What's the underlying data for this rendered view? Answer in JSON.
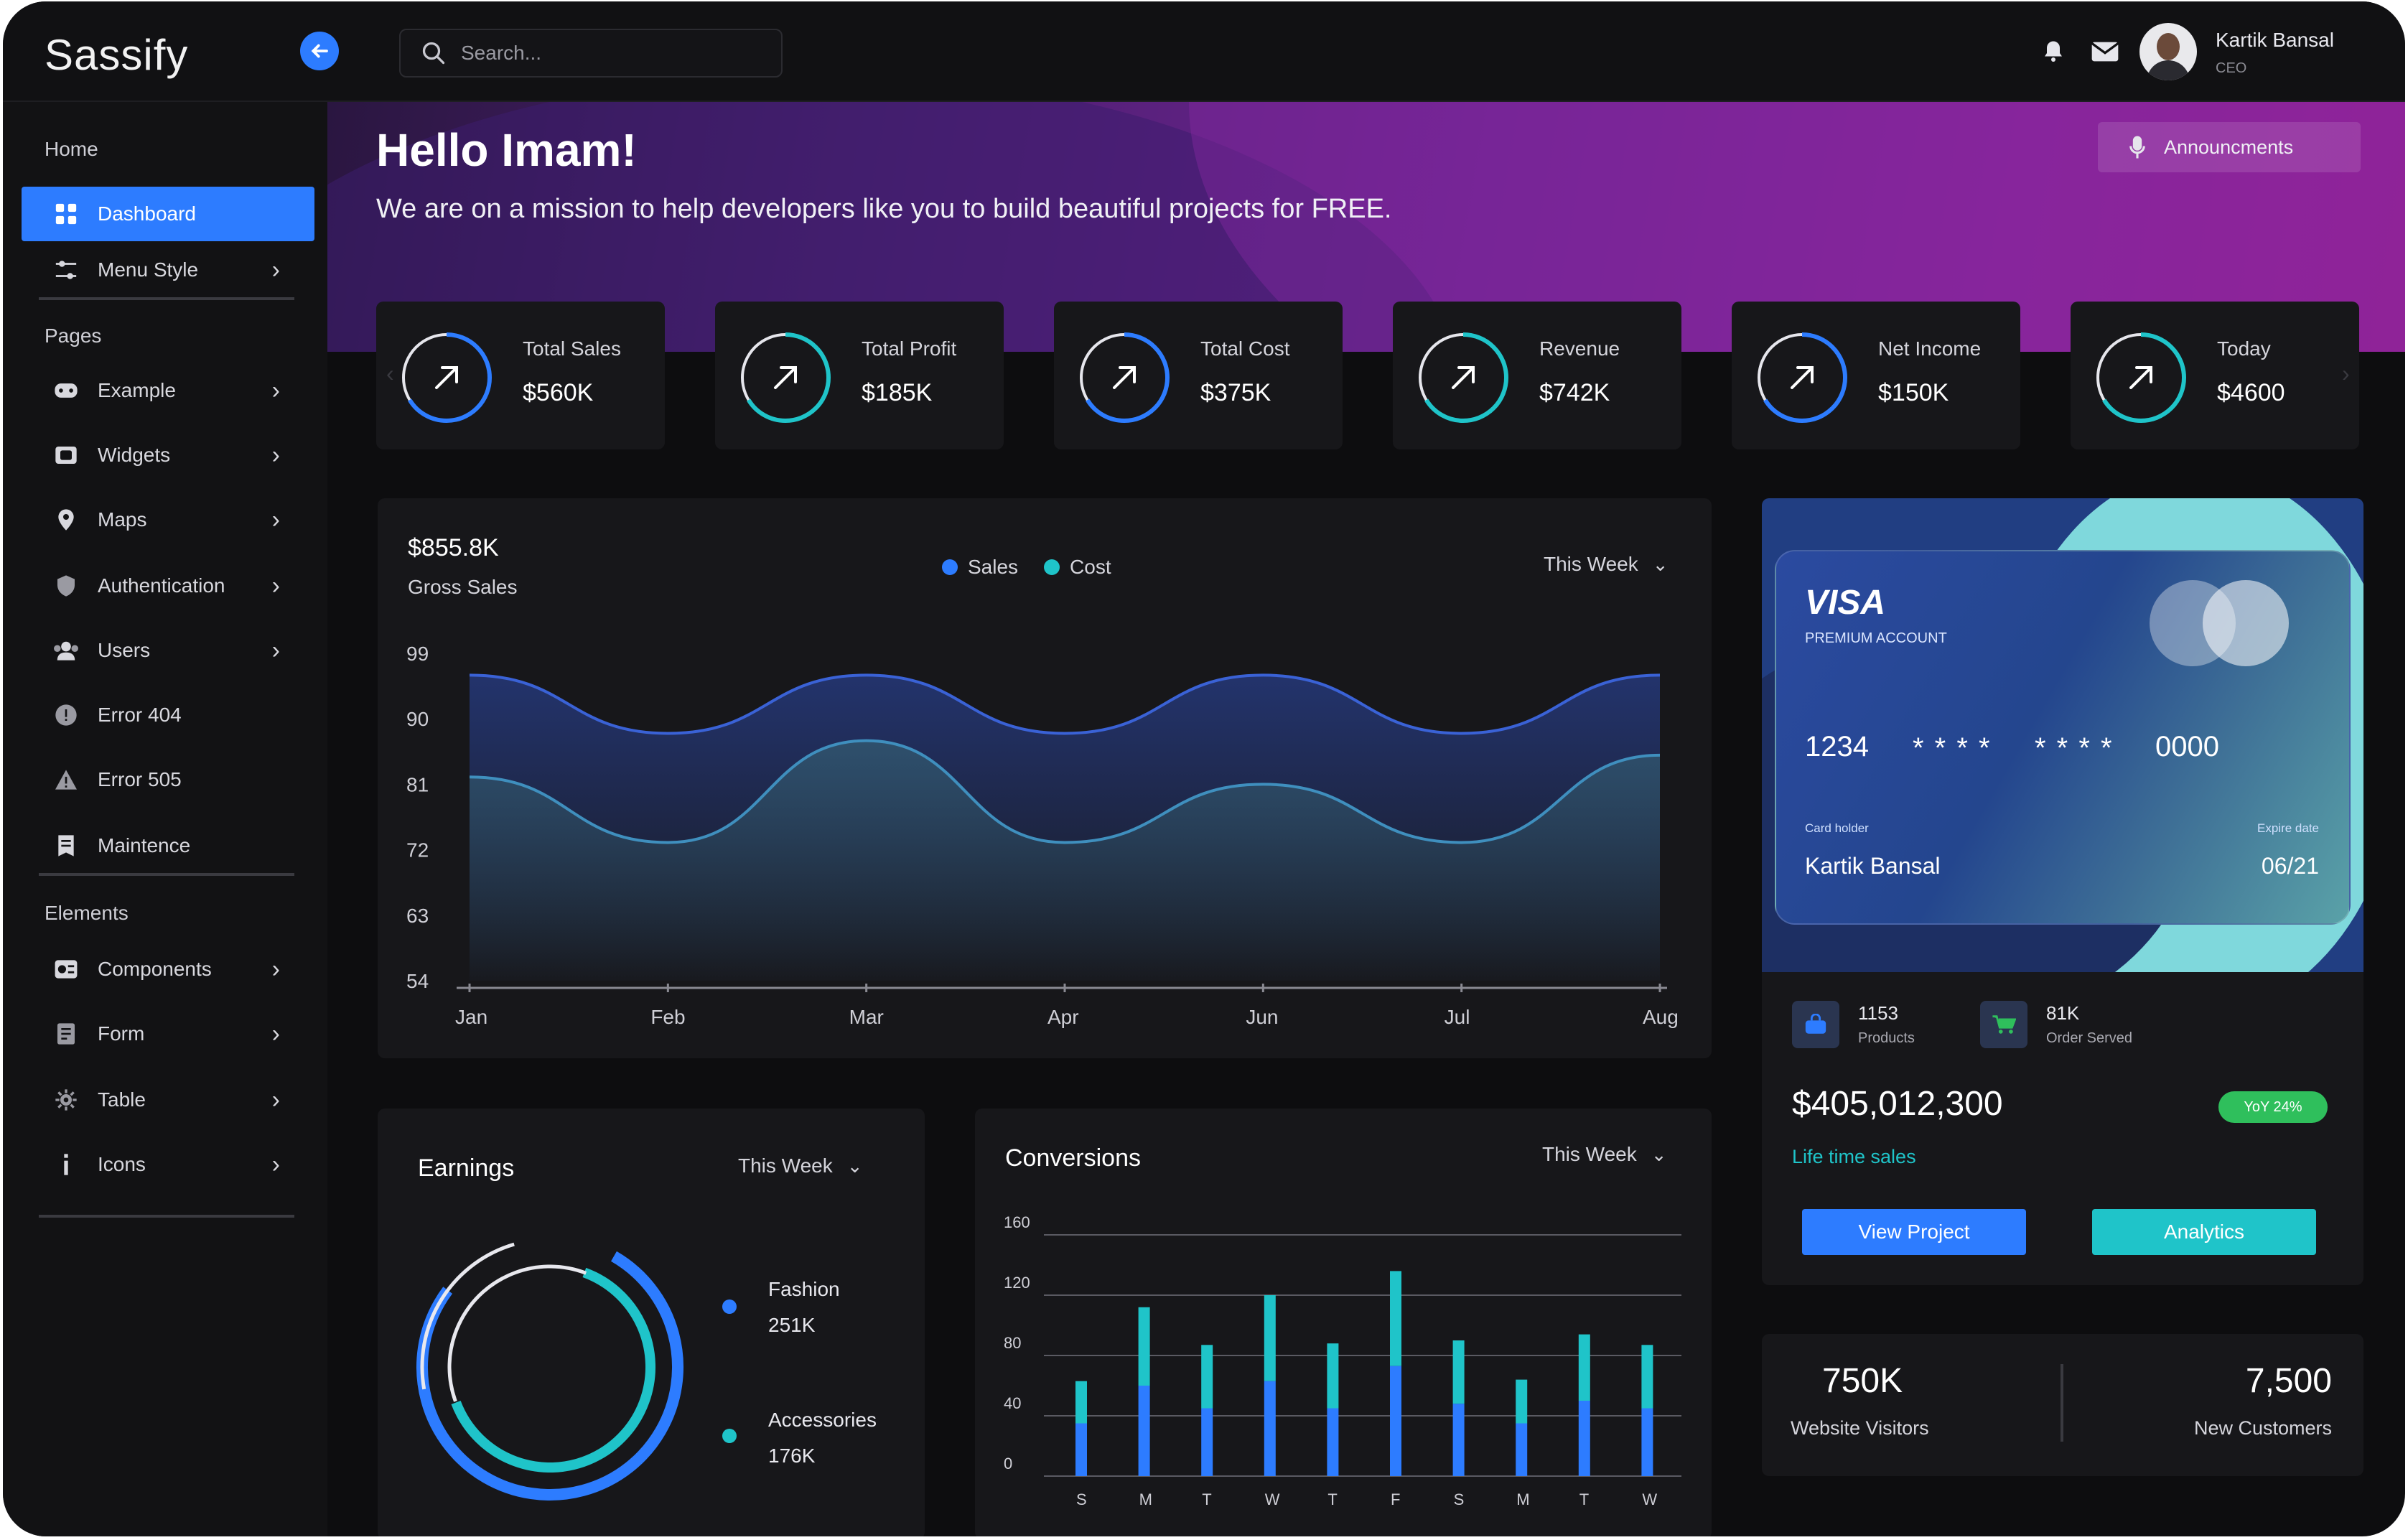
{
  "app": {
    "logo": "Sassify"
  },
  "search": {
    "placeholder": "Search..."
  },
  "user": {
    "name": "Kartik Bansal",
    "role": "CEO"
  },
  "sidebar": {
    "sections": [
      "Home",
      "Pages",
      "Elements"
    ],
    "items": [
      {
        "label": "Dashboard",
        "icon": "grid-icon",
        "active": true
      },
      {
        "label": "Menu Style",
        "icon": "sliders-icon"
      },
      {
        "label": "Example",
        "icon": "gamepad-icon"
      },
      {
        "label": "Widgets",
        "icon": "widget-icon"
      },
      {
        "label": "Maps",
        "icon": "map-pin-icon"
      },
      {
        "label": "Authentication",
        "icon": "shield-icon"
      },
      {
        "label": "Users",
        "icon": "users-icon"
      },
      {
        "label": "Error 404",
        "icon": "error-icon"
      },
      {
        "label": "Error 505",
        "icon": "warning-icon"
      },
      {
        "label": "Maintence",
        "icon": "document-icon"
      },
      {
        "label": "Components",
        "icon": "components-icon"
      },
      {
        "label": "Form",
        "icon": "form-icon"
      },
      {
        "label": "Table",
        "icon": "table-icon"
      },
      {
        "label": "Icons",
        "icon": "info-icon"
      }
    ]
  },
  "hero": {
    "greeting": "Hello Imam!",
    "subtitle": "We are on a mission to help developers like you to build beautiful projects for FREE.",
    "announcements": "Announcments"
  },
  "stats": [
    {
      "label": "Total Sales",
      "value": "$560K",
      "ring_color": "#2d7cff"
    },
    {
      "label": "Total Profit",
      "value": "$185K",
      "ring_color": "#1fc4c9"
    },
    {
      "label": "Total Cost",
      "value": "$375K",
      "ring_color": "#2d7cff"
    },
    {
      "label": "Revenue",
      "value": "$742K",
      "ring_color": "#1fc4c9"
    },
    {
      "label": "Net Income",
      "value": "$150K",
      "ring_color": "#2d7cff"
    },
    {
      "label": "Today",
      "value": "$4600",
      "ring_color": "#1fc4c9"
    }
  ],
  "gross": {
    "amount": "$855.8K",
    "label": "Gross Sales",
    "period": "This Week"
  },
  "earnings": {
    "title": "Earnings",
    "period": "This Week",
    "items": [
      {
        "name": "Fashion",
        "value": "251K",
        "color": "#2d7cff"
      },
      {
        "name": "Accessories",
        "value": "176K",
        "color": "#1fc4c9"
      }
    ]
  },
  "conversions": {
    "title": "Conversions",
    "period": "This Week"
  },
  "chart_data": [
    {
      "type": "area",
      "title": "",
      "x": [
        "Jan",
        "Feb",
        "Mar",
        "Apr",
        "Jun",
        "Jul",
        "Aug"
      ],
      "ylim": [
        54,
        99
      ],
      "yticks": [
        99,
        90,
        81,
        72,
        63,
        54
      ],
      "legend": "top-center",
      "series": [
        {
          "name": "Sales",
          "color": "#2d7cff",
          "values": [
            96,
            88,
            96,
            88,
            96,
            88,
            96
          ]
        },
        {
          "name": "Cost",
          "color": "#1fc4c9",
          "values": [
            82,
            73,
            87,
            73,
            81,
            73,
            85
          ]
        }
      ]
    },
    {
      "type": "bar",
      "categories": [
        "S",
        "M",
        "T",
        "W",
        "T",
        "F",
        "S",
        "M",
        "T",
        "W"
      ],
      "ylim": [
        0,
        160
      ],
      "yticks": [
        160,
        120,
        80,
        40,
        0
      ],
      "series": [
        {
          "color": "#2d7cff",
          "values": [
            35,
            60,
            45,
            63,
            45,
            73,
            48,
            35,
            50,
            45
          ]
        },
        {
          "color": "#1fc4c9",
          "values": [
            28,
            52,
            42,
            57,
            43,
            63,
            42,
            29,
            44,
            42
          ]
        }
      ]
    }
  ],
  "card": {
    "brand": "VISA",
    "tier": "PREMIUM ACCOUNT",
    "num1": "1234",
    "num2": "* * * *",
    "num3": "* * * *",
    "num4": "0000",
    "holder_caption": "Card holder",
    "expire_caption": "Expire date",
    "holder": "Kartik Bansal",
    "expire": "06/21"
  },
  "sales_summary": {
    "products_value": "1153",
    "products_label": "Products",
    "orders_value": "81K",
    "orders_label": "Order Served",
    "total": "$405,012,300",
    "yoy": "YoY 24%",
    "lifetime": "Life time sales",
    "view_project": "View Project",
    "analytics": "Analytics"
  },
  "visitors": {
    "website_value": "750K",
    "website_label": "Website Visitors",
    "customers_value": "7,500",
    "customers_label": "New Customers"
  },
  "colors": {
    "accent": "#2d7cff",
    "teal": "#1fc4c9",
    "success": "#2fbf5c"
  }
}
